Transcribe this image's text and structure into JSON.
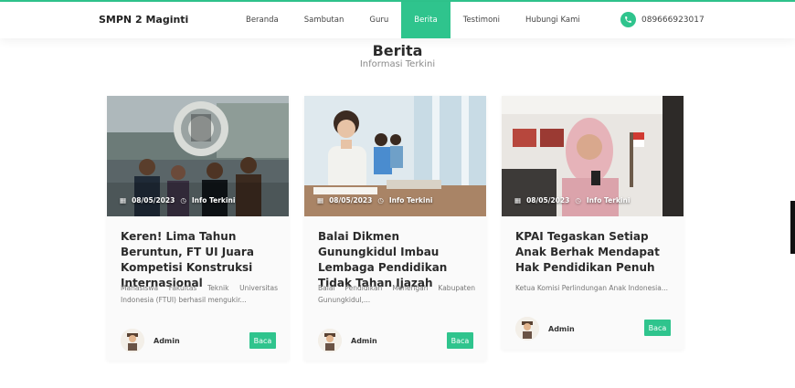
{
  "brand": "SMPN 2 Maginti",
  "nav": [
    {
      "label": "Beranda",
      "active": false
    },
    {
      "label": "Sambutan",
      "active": false
    },
    {
      "label": "Guru",
      "active": false
    },
    {
      "label": "Berita",
      "active": true
    },
    {
      "label": "Testimoni",
      "active": false
    },
    {
      "label": "Hubungi Kami",
      "active": false
    }
  ],
  "phone": {
    "icon": "phone-icon",
    "number": "089666923017"
  },
  "section": {
    "title": "Berita",
    "subtitle": "Informasi Terkini"
  },
  "cards": [
    {
      "date": "08/05/2023",
      "category": "Info Terkini",
      "title": "Keren! Lima Tahun Beruntun, FT UI Juara Kompetisi Konstruksi Internasional",
      "excerpt": "Mahasiswa Fakultas Teknik Universitas Indonesia (FTUI) berhasil mengukir...",
      "author": "Admin",
      "button": "Baca"
    },
    {
      "date": "08/05/2023",
      "category": "Info Terkini",
      "title": "Balai Dikmen Gunungkidul Imbau Lembaga Pendidikan Tidak Tahan Ijazah",
      "excerpt": "Balai Pendidikan Menengah Kabupaten Gunungkidul,...",
      "author": "Admin",
      "button": "Baca"
    },
    {
      "date": "08/05/2023",
      "category": "Info Terkini",
      "title": "KPAI Tegaskan Setiap Anak Berhak Mendapat Hak Pendidikan Penuh",
      "excerpt": "Ketua Komisi Perlindungan Anak Indonesia...",
      "author": "Admin",
      "button": "Baca"
    }
  ],
  "colors": {
    "accent": "#2fc48d",
    "text": "#2b2b2b",
    "muted": "#8a8a8a"
  }
}
